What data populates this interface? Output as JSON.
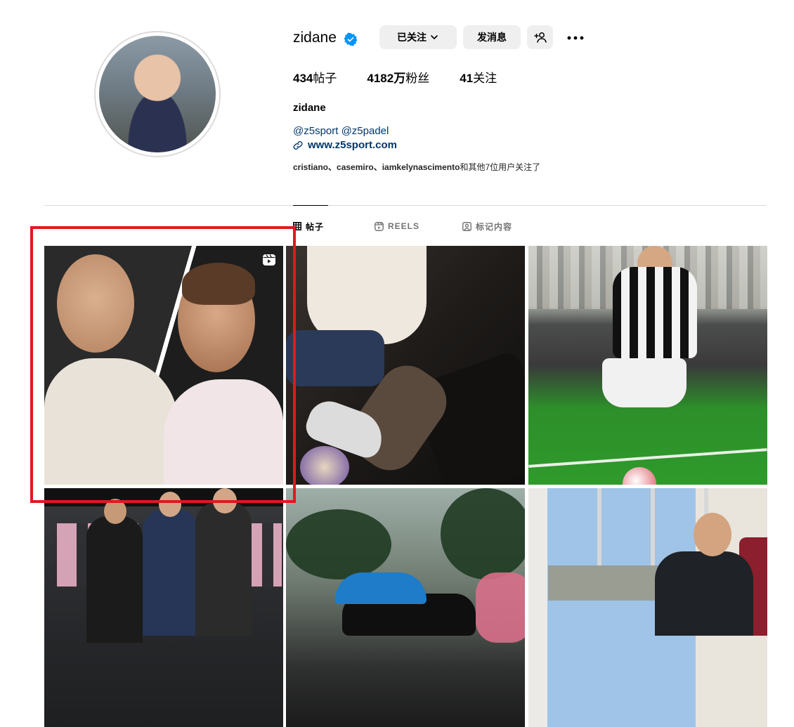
{
  "profile": {
    "username": "zidane",
    "full_name": "zidane",
    "bio_mentions": "@z5sport @z5padel",
    "website": "www.z5sport.com",
    "followed_by_prefix": "cristiano、casemiro、iamkelynascimento",
    "followed_by_suffix": "和其他7位用户关注了"
  },
  "actions": {
    "following_label": "已关注",
    "message_label": "发消息"
  },
  "stats": {
    "posts_count": "434",
    "posts_label": "帖子",
    "followers_count": "4182万",
    "followers_label": "粉丝",
    "following_count": "41",
    "following_label": "关注"
  },
  "tabs": [
    {
      "label": "帖子",
      "active": true,
      "icon": "grid-icon"
    },
    {
      "label": "REELS",
      "active": false,
      "icon": "reels-icon"
    },
    {
      "label": "标记内容",
      "active": false,
      "icon": "tagged-icon"
    }
  ],
  "colors": {
    "verified_badge": "#0095f6",
    "link": "#00376b",
    "highlight_box": "#e0191f",
    "button_bg": "#efefef"
  },
  "grid": {
    "posts": [
      {
        "type": "reel",
        "description_icon": "reel-badge-icon"
      },
      {
        "type": "photo"
      },
      {
        "type": "photo"
      },
      {
        "type": "photo"
      },
      {
        "type": "photo"
      },
      {
        "type": "photo"
      }
    ]
  }
}
